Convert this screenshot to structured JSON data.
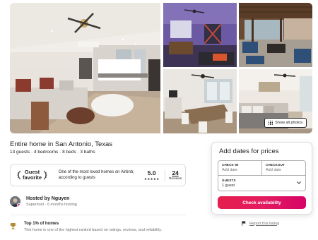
{
  "gallery": {
    "show_all_label": "Show all photos",
    "photos": [
      {
        "name": "living-room-photo"
      },
      {
        "name": "game-room-photo"
      },
      {
        "name": "patio-photo"
      },
      {
        "name": "dining-room-photo"
      },
      {
        "name": "bedroom-photo"
      }
    ]
  },
  "listing": {
    "title": "Entire home in San Antonio, Texas",
    "subtitle": "13 guests · 4 bedrooms · 8 beds · 3 baths"
  },
  "guest_favorite": {
    "badge_line1": "Guest",
    "badge_line2": "favorite",
    "description": "One of the most loved homes on Airbnb, according to guests",
    "rating": "5.0",
    "stars": "★★★★★",
    "reviews_count": "24",
    "reviews_label": "Reviews"
  },
  "host": {
    "name": "Hosted by Nguyen",
    "meta": "Superhost · 6 months hosting",
    "avatar_icon": "host-avatar",
    "superhost_badge_color": "#e0115f"
  },
  "highlight": {
    "icon": "trophy-icon",
    "title": "Top 1% of homes",
    "description": "This home is one of the highest ranked based on ratings, reviews, and reliability."
  },
  "booking": {
    "title": "Add dates for prices",
    "checkin_label": "CHECK-IN",
    "checkin_placeholder": "Add date",
    "checkout_label": "CHECKOUT",
    "checkout_placeholder": "Add date",
    "guests_label": "GUESTS",
    "guests_value": "1 guest",
    "button_label": "Check availability",
    "button_color": "#e31c5f"
  },
  "report": {
    "label": "Report this listing",
    "icon": "flag-icon"
  }
}
